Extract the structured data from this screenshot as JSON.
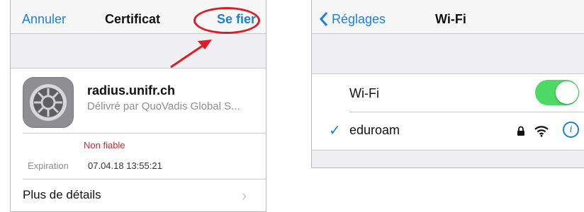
{
  "left": {
    "nav": {
      "cancel": "Annuler",
      "title": "Certificat",
      "trust": "Se fier"
    },
    "certificate": {
      "name": "radius.unifr.ch",
      "issued_by": "Délivré par QuoVadis Global S..."
    },
    "status": "Non fiable",
    "expiration": {
      "label": "Expiration",
      "value": "07.04.18 13:55:21"
    },
    "more_details": "Plus de détails"
  },
  "right": {
    "nav": {
      "back": "Réglages",
      "title": "Wi-Fi"
    },
    "wifi_toggle": {
      "label": "Wi-Fi",
      "on": true
    },
    "network": {
      "name": "eduroam",
      "secured": true,
      "connected": true
    }
  },
  "colors": {
    "accent": "#1c7fd8",
    "toggle_on": "#4cd964",
    "alert": "#e0212e",
    "highlight": "#e11b22"
  },
  "icons": [
    "settings-gear-icon",
    "chevron-right-icon",
    "chevron-left-icon",
    "checkmark-icon",
    "lock-icon",
    "wifi-signal-icon",
    "info-icon",
    "red-arrow-annotation"
  ]
}
